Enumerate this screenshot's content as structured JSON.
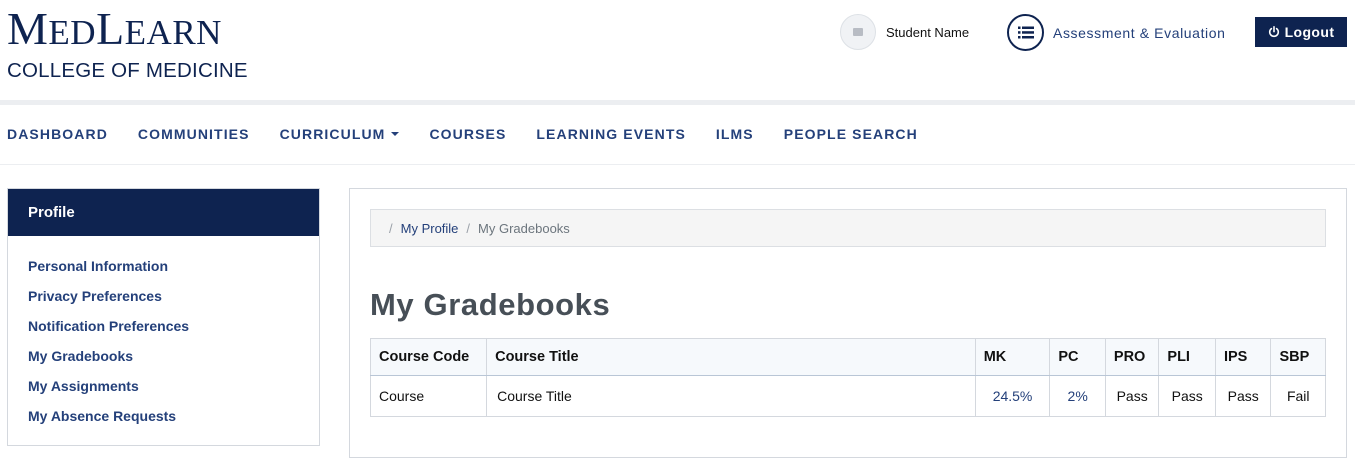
{
  "logo": {
    "line1_cap_m": "M",
    "line1_ed": "ED",
    "line1_cap_l": "L",
    "line1_earn": "EARN",
    "line2": "COLLEGE OF MEDICINE"
  },
  "header": {
    "user_name": "Student Name",
    "assessment_label": "Assessment & Evaluation",
    "logout_label": "Logout"
  },
  "nav": {
    "items": [
      "DASHBOARD",
      "COMMUNITIES",
      "CURRICULUM",
      "COURSES",
      "LEARNING EVENTS",
      "ILMS",
      "PEOPLE SEARCH"
    ]
  },
  "sidebar": {
    "title": "Profile",
    "items": [
      "Personal Information",
      "Privacy Preferences",
      "Notification Preferences",
      "My Gradebooks",
      "My Assignments",
      "My Absence Requests"
    ]
  },
  "breadcrumb": {
    "sep": "/",
    "link": "My Profile",
    "current": "My Gradebooks"
  },
  "page": {
    "title": "My Gradebooks"
  },
  "table": {
    "headers": [
      "Course Code",
      "Course Title",
      "MK",
      "PC",
      "PRO",
      "PLI",
      "IPS",
      "SBP"
    ],
    "rows": [
      [
        "Course",
        "Course Title",
        "24.5%",
        "2%",
        "Pass",
        "Pass",
        "Pass",
        "Fail"
      ]
    ]
  },
  "icons": {
    "avatar": "image-placeholder-icon",
    "assessment": "list-icon",
    "logout": "power-icon"
  },
  "colors": {
    "brand_navy": "#0e2350",
    "link_blue": "#24407a"
  }
}
